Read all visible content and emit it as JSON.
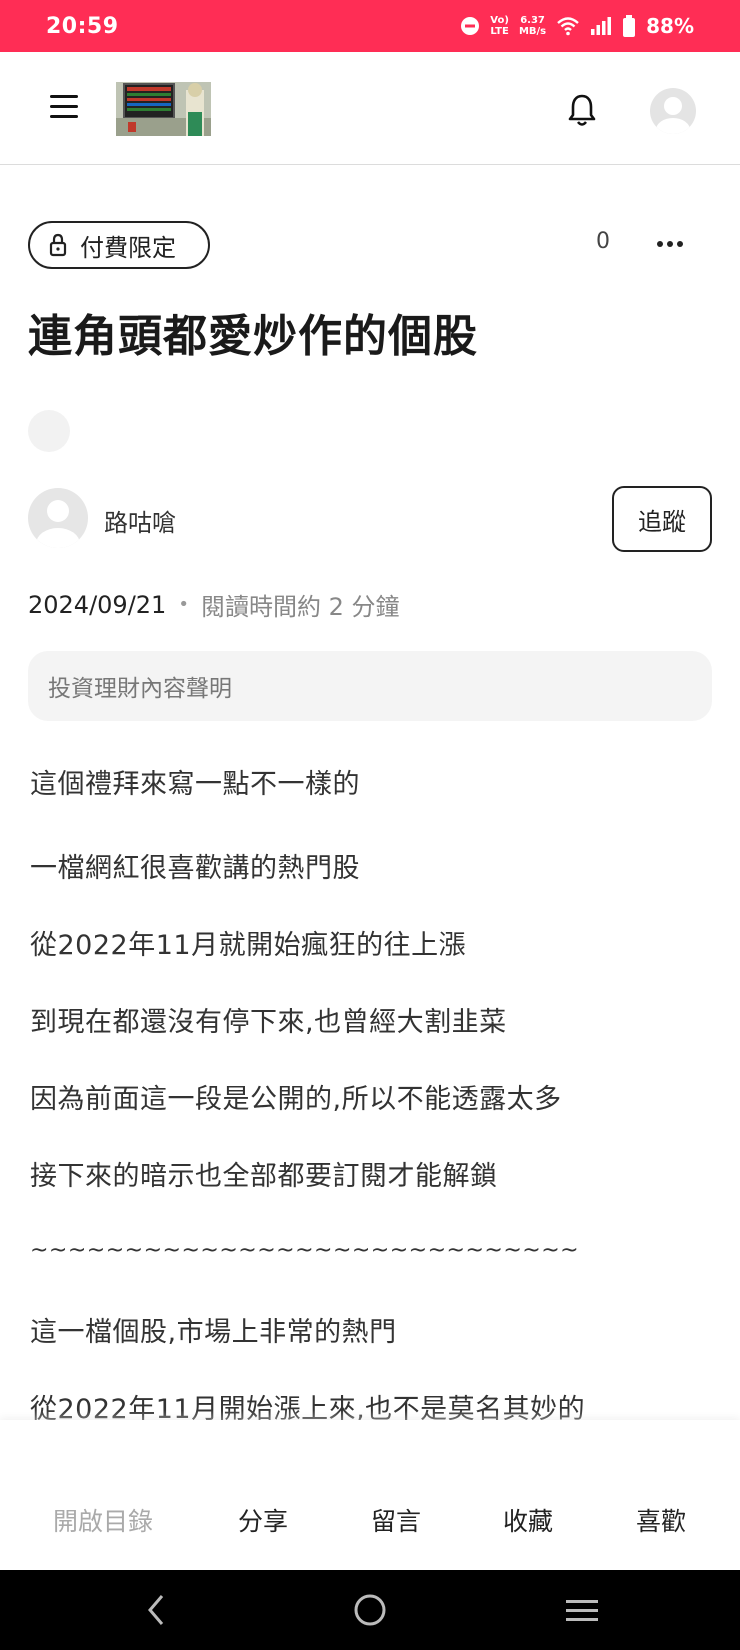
{
  "status_bar": {
    "time": "20:59",
    "network_speed_top": "6.37",
    "network_speed_bottom": "MB/s",
    "volte_top": "Vo)",
    "volte_bottom": "LTE",
    "battery": "88%"
  },
  "header": {
    "menu_icon": "hamburger-menu-icon",
    "logo": "site-logo-thumbnail",
    "bell_icon": "bell-icon",
    "avatar_icon": "user-avatar-icon"
  },
  "article": {
    "badge_label": "付費限定",
    "count": "0",
    "title": "連角頭都愛炒作的個股",
    "author": "路咕嗆",
    "follow_label": "追蹤",
    "date": "2024/09/21",
    "separator": "•",
    "read_time": "閱讀時間約 2 分鐘",
    "disclaimer": "投資理財內容聲明",
    "paragraphs": [
      "這個禮拜來寫一點不一樣的",
      "一檔網紅很喜歡講的熱門股",
      "從2022年11月就開始瘋狂的往上漲",
      "到現在都還沒有停下來,也曾經大割韭菜",
      "因為前面這一段是公開的,所以不能透露太多",
      "接下來的暗示也全部都要訂閱才能解鎖",
      "~~~~~~~~~~~~~~~~~~~~~~~~~~~~~",
      "這一檔個股,市場上非常的熱門",
      "從2022年11月開始漲上來,也不是莫名其妙的"
    ]
  },
  "action_bar": {
    "toc": "開啟目錄",
    "share": "分享",
    "comment": "留言",
    "save": "收藏",
    "like": "喜歡"
  },
  "colors": {
    "status_bar": "#ff2d55",
    "text_primary": "#222222",
    "text_muted": "#888888"
  }
}
